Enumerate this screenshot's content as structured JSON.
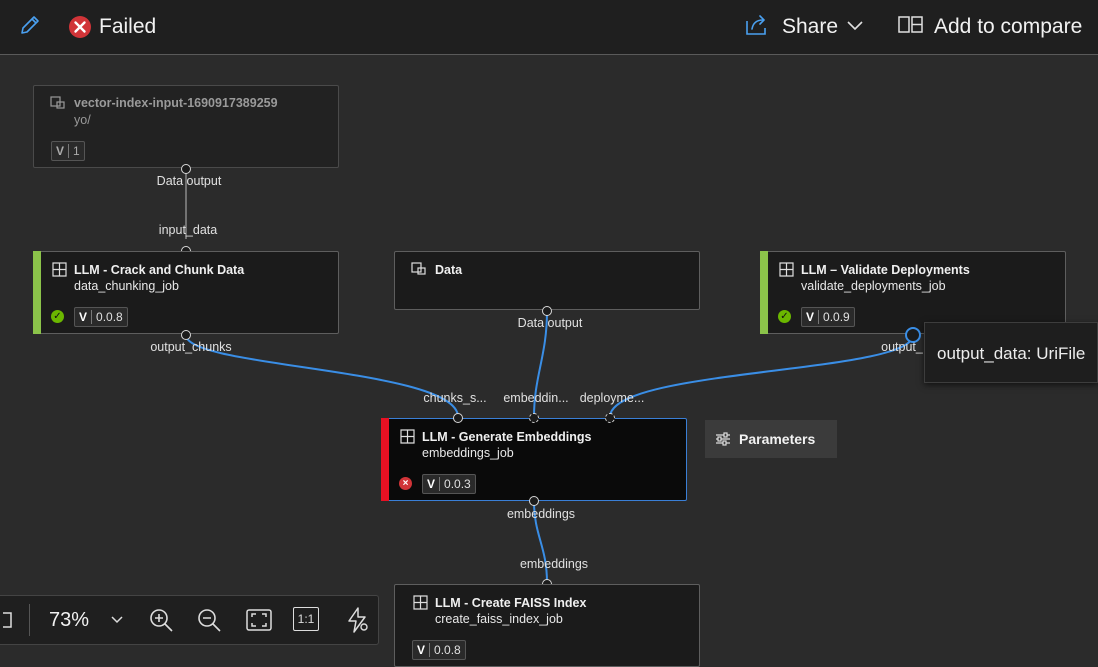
{
  "header": {
    "status_label": "Failed",
    "share_label": "Share",
    "compare_label": "Add to compare"
  },
  "colors": {
    "success": "#6bb700",
    "failed": "#d13438",
    "edge": "#3a8ee6",
    "selected_border": "#3a7fd6"
  },
  "nodes": {
    "vector_input": {
      "title": "vector-index-input-1690917389259",
      "subtitle": "yo/",
      "version": "1",
      "output_label": "Data output"
    },
    "crack_chunk": {
      "title": "LLM - Crack and Chunk Data",
      "subtitle": "data_chunking_job",
      "version": "0.0.8",
      "input_label": "input_data",
      "output_label": "output_chunks"
    },
    "data": {
      "title": "Data",
      "output_label": "Data output"
    },
    "validate": {
      "title": "LLM – Validate Deployments",
      "subtitle": "validate_deployments_job",
      "version": "0.0.9",
      "output_label": "output_"
    },
    "embeddings": {
      "title": "LLM - Generate Embeddings",
      "subtitle": "embeddings_job",
      "version": "0.0.3",
      "inputs": [
        "chunks_s...",
        "embeddin...",
        "deployme..."
      ],
      "output_label": "embeddings"
    },
    "faiss": {
      "title": "LLM - Create FAISS Index",
      "subtitle": "create_faiss_index_job",
      "version": "0.0.8",
      "input_label": "embeddings"
    }
  },
  "tooltip": "output_data: UriFile",
  "parameters_label": "Parameters",
  "zoom": {
    "level": "73%",
    "reset_label": "1:1"
  }
}
